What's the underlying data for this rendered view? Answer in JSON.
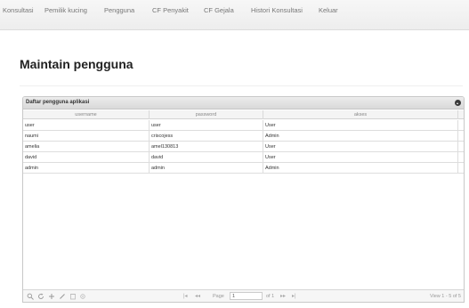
{
  "nav": {
    "items": [
      "Konsultasi",
      "Pemilik kucing",
      "Pengguna",
      "CF Penyakit",
      "CF Gejala",
      "Histori Konsultasi",
      "Keluar"
    ]
  },
  "page": {
    "title": "Maintain pengguna"
  },
  "grid": {
    "caption": "Daftar pengguna aplikasi",
    "columns": [
      "username",
      "password",
      "akses"
    ],
    "rows": [
      [
        "user",
        "user",
        "User"
      ],
      [
        "naumi",
        "criscojess",
        "Admin"
      ],
      [
        "amelia",
        "amel130813",
        "User"
      ],
      [
        "david",
        "david",
        "User"
      ],
      [
        "admin",
        "admin",
        "Admin"
      ]
    ]
  },
  "pager": {
    "icons": [
      "search-icon",
      "refresh-icon",
      "add-icon",
      "edit-icon",
      "delete-icon",
      "view-icon"
    ],
    "first": "|◂",
    "prev": "◂◂",
    "page_label": "Page",
    "page_value": "1",
    "of_label": "of 1",
    "next": "▸▸",
    "last": "▸|",
    "view_text": "View 1 - 5 of 5"
  }
}
